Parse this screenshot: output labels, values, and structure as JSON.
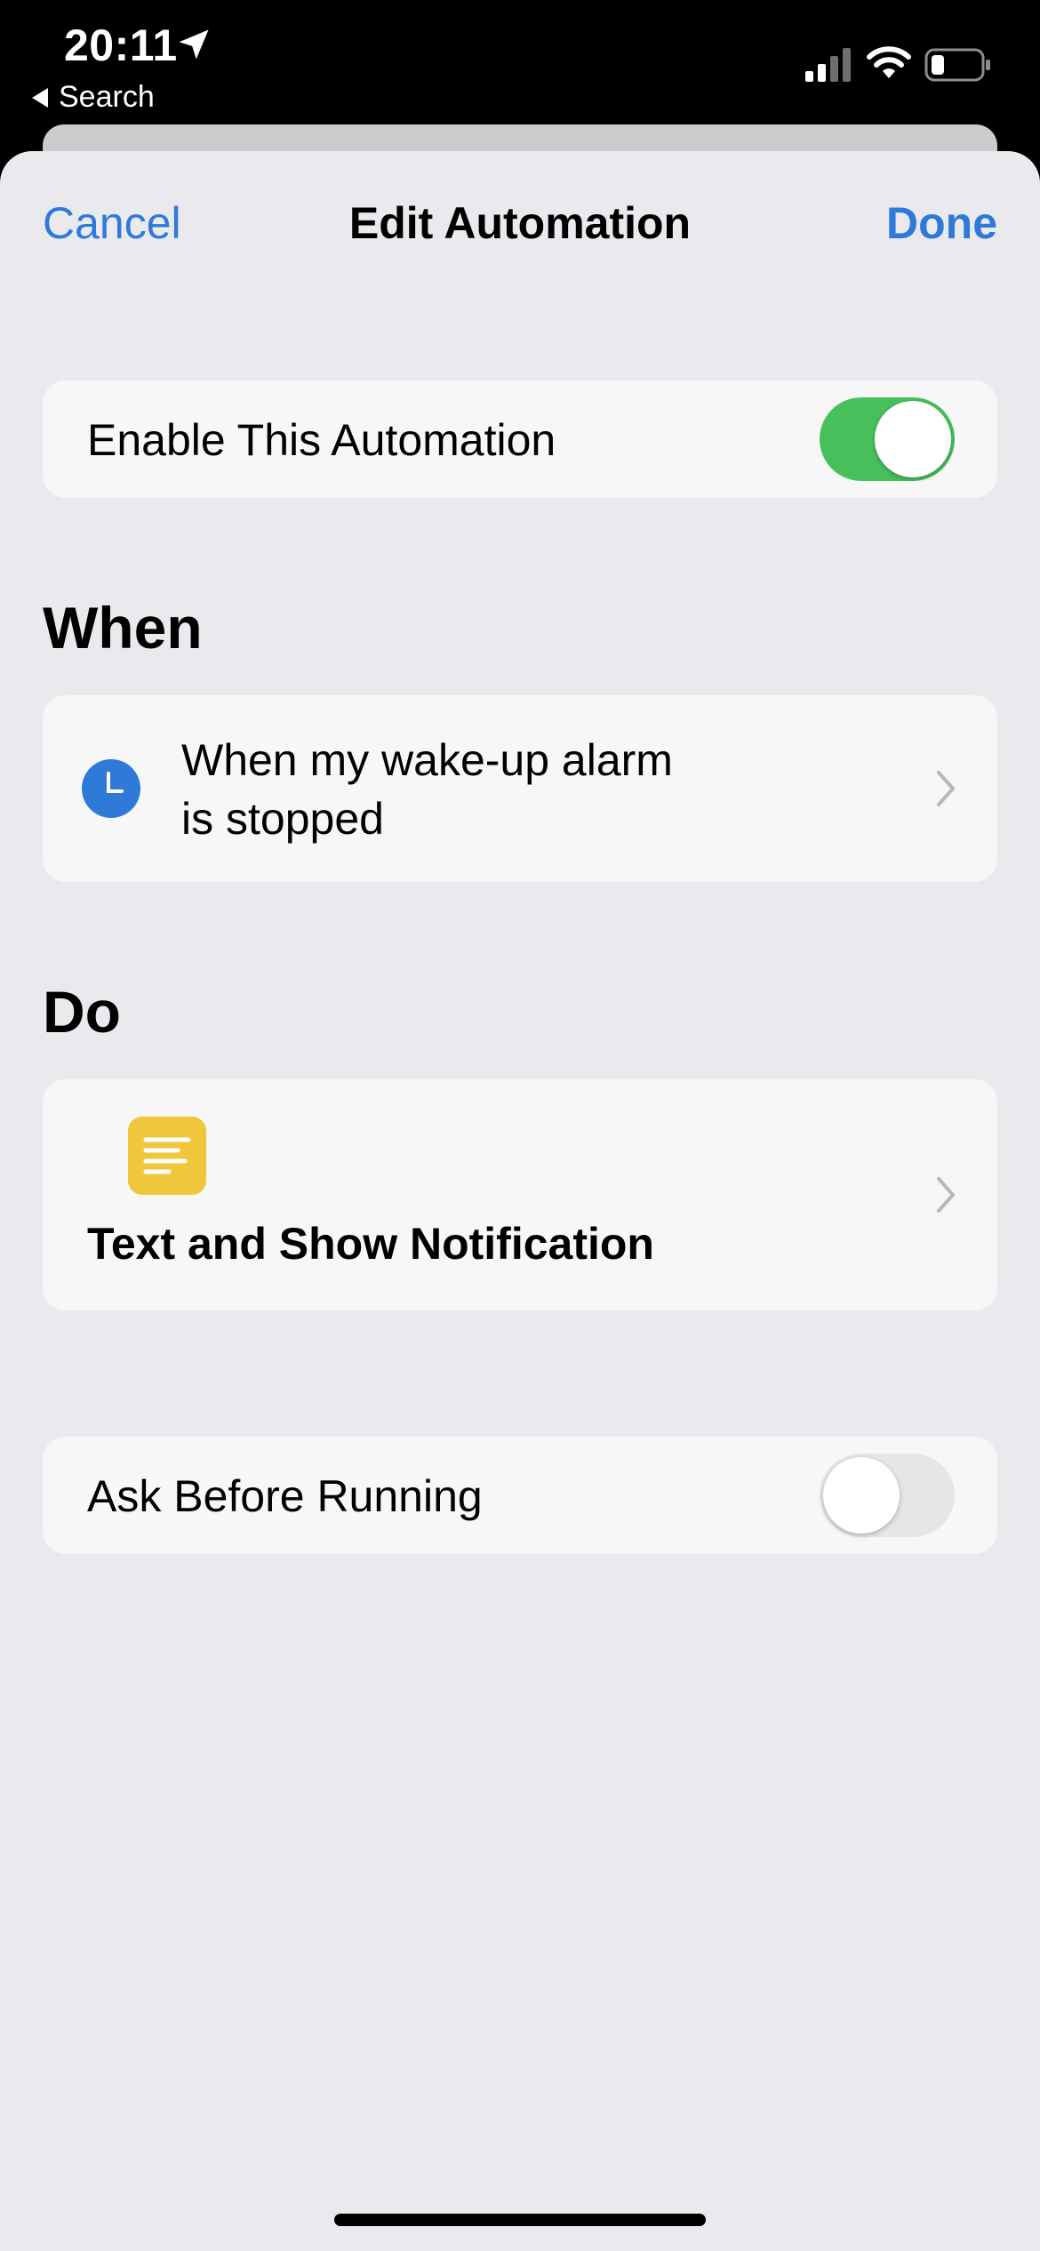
{
  "status_bar": {
    "time": "20:11",
    "back_label": "Search"
  },
  "nav": {
    "cancel_label": "Cancel",
    "title": "Edit Automation",
    "done_label": "Done"
  },
  "enable_row": {
    "label": "Enable This Automation",
    "toggle_state": "on"
  },
  "when_section": {
    "header": "When",
    "trigger_line1": "When my wake-up alarm",
    "trigger_line2": "is stopped",
    "icon": "clock-icon"
  },
  "do_section": {
    "header": "Do",
    "action_label": "Text and Show Notification",
    "icon": "notes-icon"
  },
  "ask_row": {
    "label": "Ask Before Running",
    "toggle_state": "off"
  },
  "colors": {
    "accent": "#2f7ad9",
    "toggle_on": "#47c05c",
    "clock_blue": "#2f7ad9",
    "notes_yellow": "#f0c63a"
  }
}
